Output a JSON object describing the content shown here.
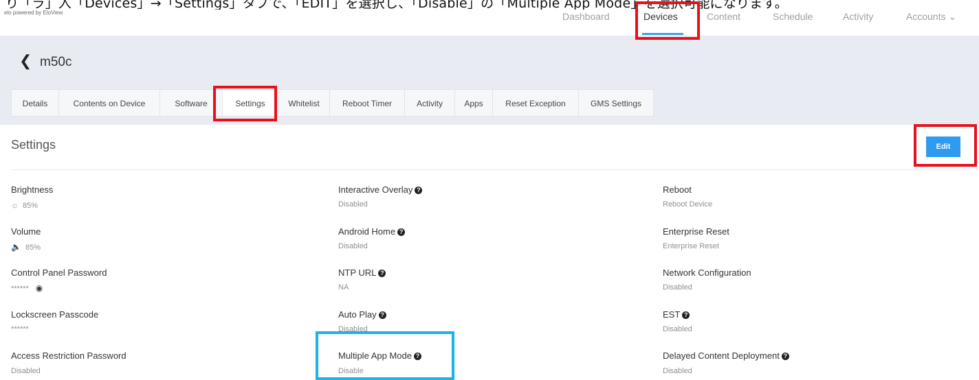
{
  "caption": {
    "text": "り「ラ」入「Devices」→「Settings」タブで、「EDIT」を選択し、「Disable」の「Multiple App Mode」を選択可能になります。"
  },
  "header": {
    "brand": "elo powered by EloView",
    "nav": [
      {
        "label": "Dashboard",
        "active": false
      },
      {
        "label": "Devices",
        "active": true
      },
      {
        "label": "Content",
        "active": false
      },
      {
        "label": "Schedule",
        "active": false
      },
      {
        "label": "Activity",
        "active": false
      },
      {
        "label": "Accounts ⌄",
        "active": false
      }
    ]
  },
  "page": {
    "back_glyph": "❮",
    "device_name": "m50c"
  },
  "tabs": [
    {
      "label": "Details",
      "active": false
    },
    {
      "label": "Contents on Device",
      "active": false
    },
    {
      "label": "Software",
      "active": false
    },
    {
      "label": "Settings",
      "active": true
    },
    {
      "label": "Whitelist",
      "active": false
    },
    {
      "label": "Reboot Timer",
      "active": false
    },
    {
      "label": "Activity",
      "active": false
    },
    {
      "label": "Apps",
      "active": false
    },
    {
      "label": "Reset Exception",
      "active": false
    },
    {
      "label": "GMS Settings",
      "active": false
    }
  ],
  "settings": {
    "title": "Settings",
    "edit_label": "Edit",
    "help_glyph": "?",
    "col1": [
      {
        "label": "Brightness",
        "value": "85%",
        "icon": "brightness-icon",
        "glyph": "☼"
      },
      {
        "label": "Volume",
        "value": "85%",
        "icon": "volume-icon",
        "glyph": "🔈"
      },
      {
        "label": "Control Panel Password",
        "value": "******",
        "icon": "eye-icon",
        "glyph": "◉"
      },
      {
        "label": "Lockscreen Passcode",
        "value": "******"
      },
      {
        "label": "Access Restriction Password",
        "value": "Disabled"
      }
    ],
    "col2": [
      {
        "label": "Interactive Overlay",
        "value": "Disabled",
        "help": true
      },
      {
        "label": "Android Home",
        "value": "Disabled",
        "help": true
      },
      {
        "label": "NTP URL",
        "value": "NA",
        "help": true
      },
      {
        "label": "Auto Play",
        "value": "Disabled",
        "help": true
      },
      {
        "label": "Multiple App Mode",
        "value": "Disable",
        "help": true
      }
    ],
    "col3": [
      {
        "label": "Reboot",
        "value": "Reboot Device"
      },
      {
        "label": "Enterprise Reset",
        "value": "Enterprise Reset"
      },
      {
        "label": "Network Configuration",
        "value": "Disabled"
      },
      {
        "label": "EST",
        "value": "Disabled",
        "help": true
      },
      {
        "label": "Delayed Content Deployment",
        "value": "Disabled",
        "help": true
      }
    ]
  },
  "colors": {
    "accent": "#2e9bf0",
    "highlight_red": "#e8101a",
    "highlight_blue": "#19b3ea"
  }
}
